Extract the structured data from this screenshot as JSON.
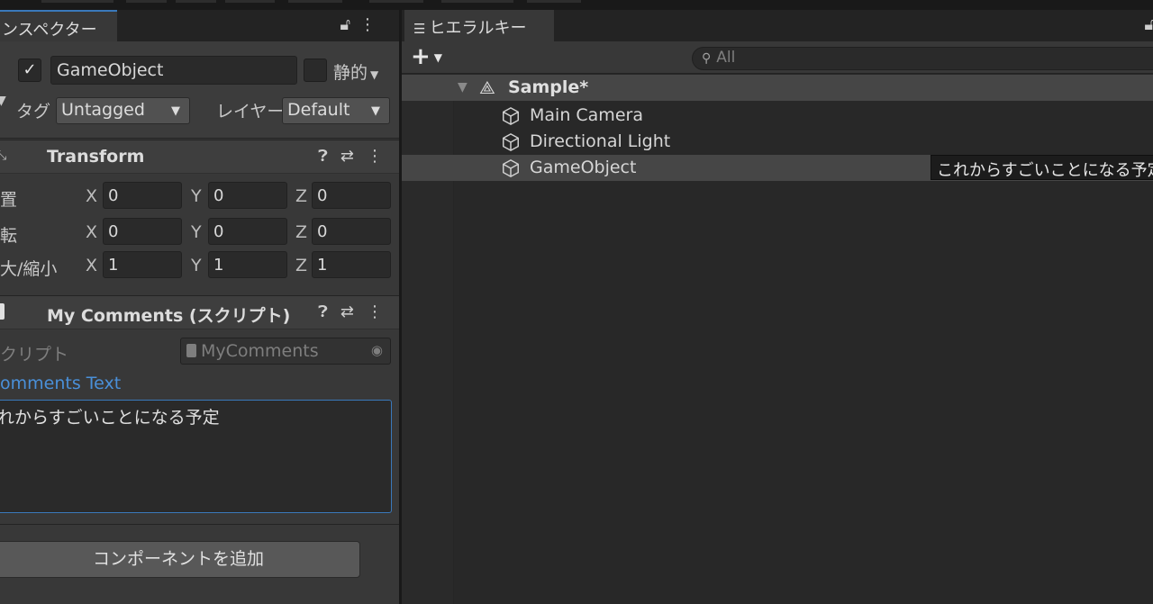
{
  "inspector": {
    "tab_label": "ンスペクター",
    "tab_icons": {
      "lock": "lock-icon",
      "menu": "kebab-menu-icon"
    },
    "gameobject": {
      "active_checked": true,
      "name": "GameObject",
      "static_label": "静的",
      "tag_label": "タグ",
      "tag_value": "Untagged",
      "layer_label": "レイヤー",
      "layer_value": "Default"
    },
    "transform": {
      "title": "Transform",
      "position_label": "置",
      "rotation_label": "転",
      "scale_label": "大/縮小",
      "position": {
        "x": "0",
        "y": "0",
        "z": "0"
      },
      "rotation": {
        "x": "0",
        "y": "0",
        "z": "0"
      },
      "scale": {
        "x": "1",
        "y": "1",
        "z": "1"
      },
      "axis_x": "X",
      "axis_y": "Y",
      "axis_z": "Z"
    },
    "my_comments": {
      "title": "My Comments (スクリプト)",
      "script_label": "クリプト",
      "script_value": "MyComments",
      "comments_label": "omments Text",
      "comments_value": "れからすごいことになる予定"
    },
    "add_component_label": "コンポーネントを追加"
  },
  "hierarchy": {
    "tab_label": "ヒエラルキー",
    "search_placeholder": "All",
    "scene_name": "Sample*",
    "items": [
      {
        "name": "Main Camera",
        "selected": false
      },
      {
        "name": "Directional Light",
        "selected": false
      },
      {
        "name": "GameObject",
        "selected": true
      }
    ],
    "tooltip": "これからすごいことになる予定"
  },
  "colors": {
    "accent": "#3a79bb",
    "panel": "#383838",
    "background": "#282828",
    "selection": "#464646"
  }
}
